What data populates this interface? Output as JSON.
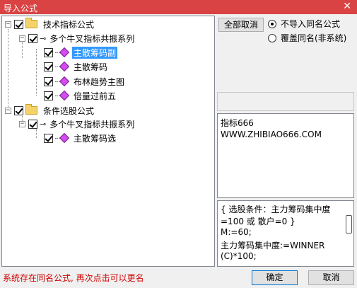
{
  "window": {
    "title": "导入公式",
    "close_glyph": "✕"
  },
  "tree": {
    "nodes": [
      {
        "label": "技术指标公式",
        "checked": true,
        "type": "folder",
        "expander": "−"
      },
      {
        "label": "多个牛叉指标共振系列",
        "checked": true,
        "type": "group",
        "expander": "−"
      },
      {
        "label": "主散筹码副",
        "checked": true,
        "type": "formula",
        "selected": true
      },
      {
        "label": "主散筹码",
        "checked": true,
        "type": "formula"
      },
      {
        "label": "布林趋势主图",
        "checked": true,
        "type": "formula"
      },
      {
        "label": "倍量过前五",
        "checked": true,
        "type": "formula"
      },
      {
        "label": "条件选股公式",
        "checked": true,
        "type": "folder",
        "expander": "−"
      },
      {
        "label": "多个牛叉指标共振系列",
        "checked": true,
        "type": "group",
        "expander": "−"
      },
      {
        "label": "主散筹码选",
        "checked": true,
        "type": "formula"
      }
    ]
  },
  "controls": {
    "cancel_all": "全部取消",
    "radio_no_import": "不导入同名公式",
    "radio_overwrite": "覆盖同名(非系统)",
    "selected_radio": "no_import"
  },
  "info": {
    "line1": "指标666",
    "line2": "WWW.ZHIBIAO666.COM"
  },
  "code": {
    "lines": [
      "{ 选股条件：主力筹码集中度",
      "=100 或 散户=0 }",
      "M:=60;",
      "主力筹码集中度:=WINNER",
      "(C)*100;"
    ]
  },
  "footer": {
    "status": "系统存在同名公式, 再次点击可以更名",
    "ok": "确定",
    "cancel": "取消"
  },
  "colors": {
    "titlebar": "#d94343",
    "status_text": "#d00000",
    "selection": "#3399ff",
    "formula_icon": "#d24cf0"
  },
  "icons": [
    "close-icon",
    "folder-icon",
    "key-icon",
    "formula-gem-icon",
    "checkbox-icon",
    "expander-icon"
  ]
}
